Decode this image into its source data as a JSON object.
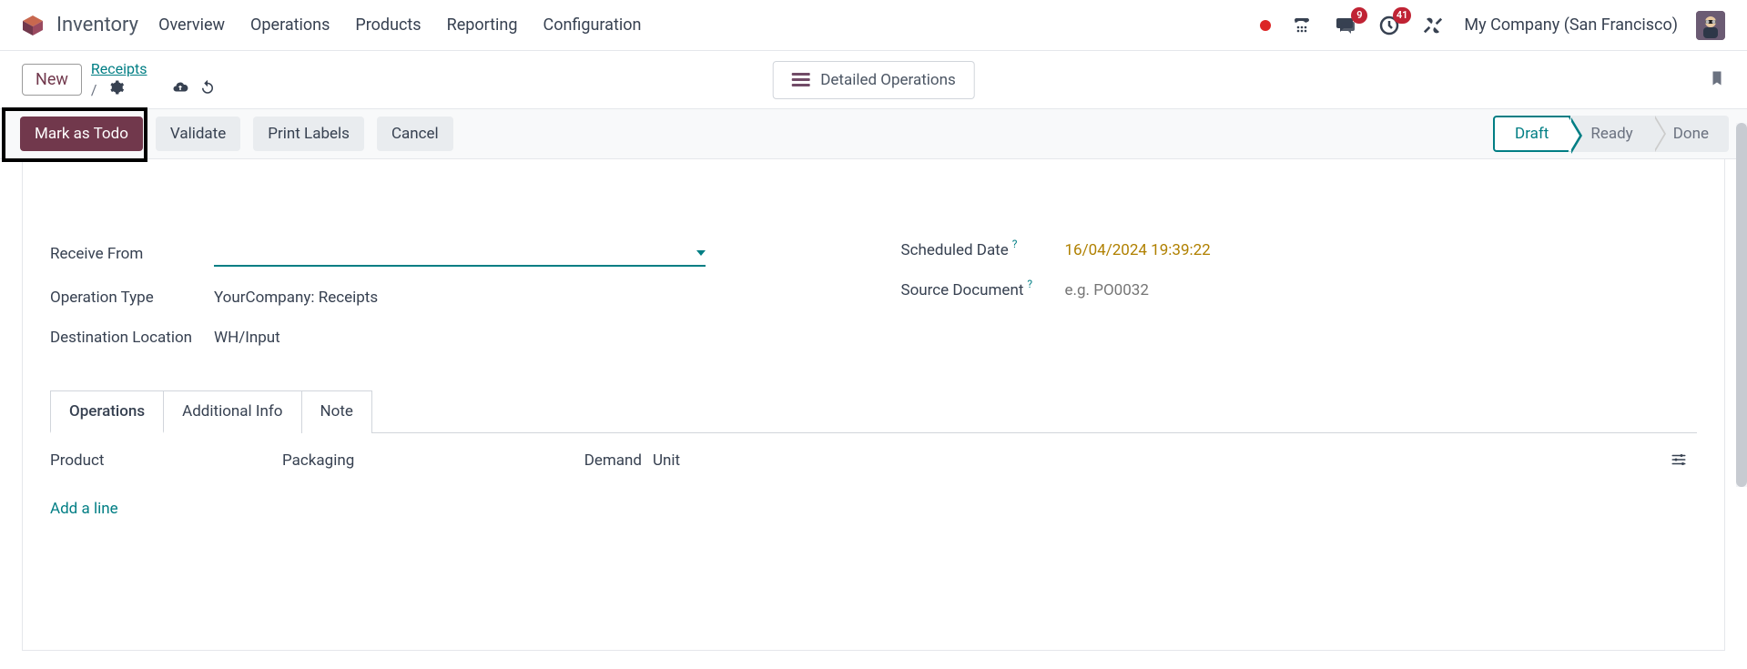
{
  "brand": "Inventory",
  "nav": {
    "items": [
      "Overview",
      "Operations",
      "Products",
      "Reporting",
      "Configuration"
    ]
  },
  "header": {
    "chat_badge": "9",
    "activity_badge": "41",
    "company": "My Company (San Francisco)"
  },
  "cp": {
    "new_btn": "New",
    "breadcrumb": "Receipts",
    "slash": "/",
    "detailed": "Detailed Operations"
  },
  "actions": {
    "mark_todo": "Mark as Todo",
    "validate": "Validate",
    "print_labels": "Print Labels",
    "cancel": "Cancel"
  },
  "status": {
    "draft": "Draft",
    "ready": "Ready",
    "done": "Done"
  },
  "form": {
    "receive_from_label": "Receive From",
    "operation_type_label": "Operation Type",
    "operation_type_value": "YourCompany: Receipts",
    "destination_label": "Destination Location",
    "destination_value": "WH/Input",
    "scheduled_label": "Scheduled Date",
    "scheduled_value": "16/04/2024 19:39:22",
    "source_label": "Source Document",
    "source_placeholder": "e.g. PO0032",
    "help_marker": "?"
  },
  "tabs": {
    "operations": "Operations",
    "additional": "Additional Info",
    "note": "Note"
  },
  "table": {
    "product": "Product",
    "packaging": "Packaging",
    "demand": "Demand",
    "unit": "Unit",
    "add_line": "Add a line"
  }
}
